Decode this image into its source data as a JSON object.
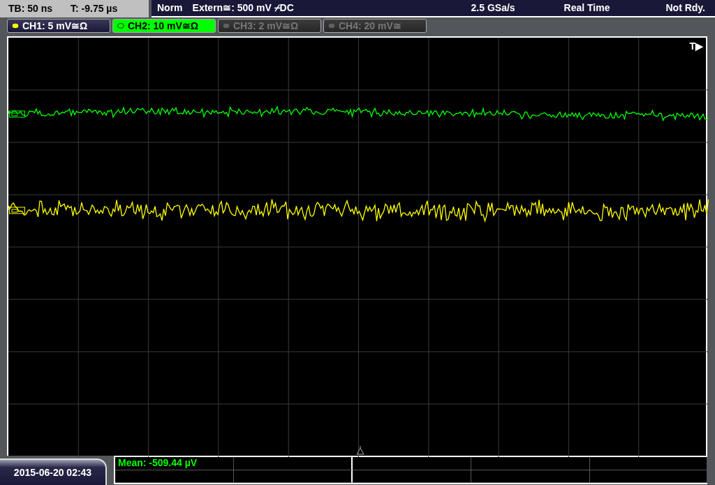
{
  "status_bar": {
    "timebase": "TB: 50 ns",
    "trigger_time": "T: -9.75 µs",
    "mode": "Norm",
    "trigger_source": "Extern≅: 500 mV ⌿DC",
    "sample_rate": "2.5 GSa/s",
    "acquisition": "Real Time",
    "trigger_state": "Not Rdy."
  },
  "channels": [
    {
      "label": "CH1: 5 mV≅Ω",
      "color": "#ffff00",
      "on": true,
      "selected": false
    },
    {
      "label": "CH2: 10 mV≅Ω",
      "color": "#00ff00",
      "on": true,
      "selected": true
    },
    {
      "label": "CH3: 2 mV≅Ω",
      "color": "#606060",
      "on": false,
      "selected": false
    },
    {
      "label": "CH4: 20 mV≅",
      "color": "#606060",
      "on": false,
      "selected": false
    }
  ],
  "screen": {
    "trigger_marker": "T▶"
  },
  "measurements": {
    "rows": [
      [
        "Mean: -509.44 µV"
      ]
    ]
  },
  "date_time": "2015-06-20 02:43"
}
